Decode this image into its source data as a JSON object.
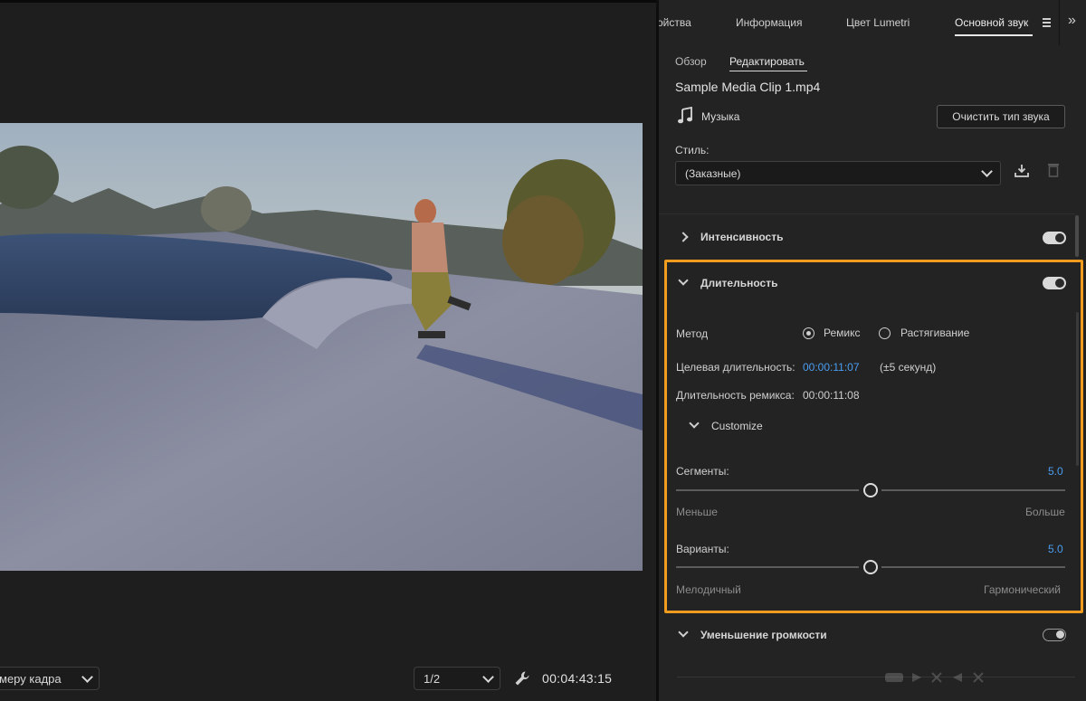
{
  "monitor": {
    "fit_label": "меру кадра",
    "resolution_label": "1/2",
    "timecode": "00:04:43:15"
  },
  "panel": {
    "tabs": [
      {
        "label": "ойства"
      },
      {
        "label": "Информация"
      },
      {
        "label": "Цвет Lumetri"
      },
      {
        "label": "Основной звук",
        "active": true
      }
    ],
    "subtabs": {
      "overview": "Обзор",
      "edit": "Редактировать"
    },
    "clip_name": "Sample Media Clip 1.mp4",
    "clip_type": "Музыка",
    "clear_type_button": "Очистить тип звука",
    "style": {
      "label": "Стиль:",
      "value": "(Заказные)"
    },
    "sections": {
      "intensity": {
        "title": "Интенсивность",
        "enabled": true,
        "expanded": false
      },
      "duration": {
        "title": "Длительность",
        "enabled": true,
        "expanded": true,
        "method_label": "Метод",
        "methods": [
          "Ремикс",
          "Растягивание"
        ],
        "selected_method": "Ремикс",
        "target_label": "Целевая длительность:",
        "target_value": "00:00:11:07",
        "target_tolerance": "(±5 секунд)",
        "remix_label": "Длительность ремикса:",
        "remix_value": "00:00:11:08",
        "customize_label": "Customize",
        "segments": {
          "label": "Сегменты:",
          "value": "5.0",
          "min_label": "Меньше",
          "max_label": "Больше",
          "level": 0.5
        },
        "variations": {
          "label": "Варианты:",
          "value": "5.0",
          "min_label": "Мелодичный",
          "max_label": "Гармонический",
          "level": 0.5
        }
      },
      "ducking": {
        "title": "Уменьшение громкости",
        "enabled": false,
        "expanded": false
      }
    }
  },
  "colors": {
    "highlight": "#f19c1f",
    "accent_blue": "#4a9df0",
    "background": "#232323"
  }
}
